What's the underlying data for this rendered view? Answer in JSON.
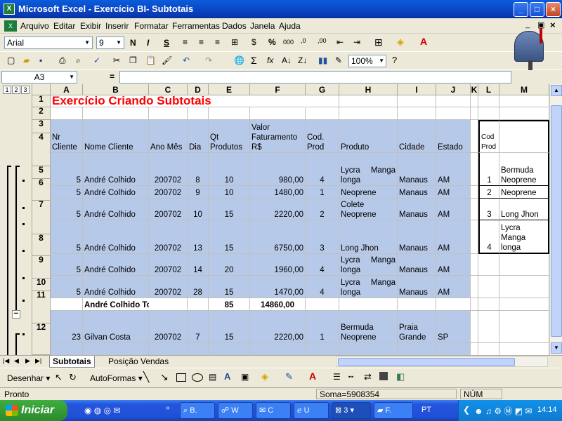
{
  "window": {
    "title": "Microsoft Excel - Exercício BI- Subtotais"
  },
  "menu": [
    "Arquivo",
    "Editar",
    "Exibir",
    "Inserir",
    "Formatar",
    "Ferramentas",
    "Dados",
    "Janela",
    "Ajuda"
  ],
  "format_toolbar": {
    "font": "Arial",
    "size": "9"
  },
  "standard_toolbar": {
    "zoom": "100%"
  },
  "formula_bar": {
    "name_box": "A3",
    "equals": "="
  },
  "outline_levels": [
    "1",
    "2",
    "3"
  ],
  "columns": [
    "A",
    "B",
    "C",
    "D",
    "E",
    "F",
    "G",
    "H",
    "I",
    "J",
    "K",
    "L",
    "M"
  ],
  "sheet": {
    "title": "Exercício Criando Subtotais",
    "headers": {
      "A": "Nr Cliente",
      "B": "Nome Cliente",
      "C": "Ano Mês",
      "D": "Dia",
      "E": "Qt Produtos",
      "F": "Valor Faturamento R$",
      "G": "Cod. Prod",
      "H": "Produto",
      "I": "Cidade",
      "J": "Estado",
      "L": "Cod Prod"
    },
    "rows": [
      {
        "n": "4",
        "A": "5",
        "B": "André Colhido",
        "C": "200702",
        "D": "8",
        "E": "10",
        "F": "980,00",
        "G": "4",
        "H": "Lycra Manga longa",
        "I": "Manaus",
        "J": "AM",
        "L": "1",
        "M": "Bermuda Neoprene"
      },
      {
        "n": "5",
        "A": "5",
        "B": "André Colhido",
        "C": "200702",
        "D": "9",
        "E": "10",
        "F": "1480,00",
        "G": "1",
        "H": "Neoprene",
        "I": "Manaus",
        "J": "AM",
        "L": "2",
        "M": "Neoprene"
      },
      {
        "n": "6",
        "A": "5",
        "B": "André Colhido",
        "C": "200702",
        "D": "10",
        "E": "15",
        "F": "2220,00",
        "G": "2",
        "H": "Colete Neoprene",
        "I": "Manaus",
        "J": "AM",
        "L": "3",
        "M": "Long Jhon"
      },
      {
        "n": "7",
        "A": "5",
        "B": "André Colhido",
        "C": "200702",
        "D": "13",
        "E": "15",
        "F": "6750,00",
        "G": "3",
        "H": "Long Jhon",
        "I": "Manaus",
        "J": "AM",
        "L": "4",
        "M": "Lycra Manga longa"
      },
      {
        "n": "8",
        "A": "5",
        "B": "André Colhido",
        "C": "200702",
        "D": "14",
        "E": "20",
        "F": "1960,00",
        "G": "4",
        "H": "Lycra Manga longa",
        "I": "Manaus",
        "J": "AM",
        "L": "",
        "M": ""
      },
      {
        "n": "9",
        "A": "5",
        "B": "André Colhido",
        "C": "200702",
        "D": "28",
        "E": "15",
        "F": "1470,00",
        "G": "4",
        "H": "Lycra Manga longa",
        "I": "Manaus",
        "J": "AM",
        "L": "",
        "M": ""
      },
      {
        "n": "10",
        "A": "",
        "B": "André Colhido Total",
        "C": "",
        "D": "",
        "E": "85",
        "F": "14860,00",
        "G": "",
        "H": "",
        "I": "",
        "J": "",
        "L": "",
        "M": ""
      },
      {
        "n": "11",
        "A": "23",
        "B": "Gilvan Costa",
        "C": "200702",
        "D": "7",
        "E": "15",
        "F": "2220,00",
        "G": "1",
        "H": "Bermuda Neoprene",
        "I": "Praia Grande",
        "J": "SP",
        "L": "",
        "M": ""
      },
      {
        "n": "12",
        "A": "",
        "B": "",
        "C": "",
        "D": "",
        "E": "",
        "F": "",
        "G": "",
        "H": "Lycra Manga",
        "I": "Praia",
        "J": "",
        "L": "",
        "M": ""
      }
    ]
  },
  "sheet_tabs": [
    "Subtotais",
    "Posição Vendas"
  ],
  "draw_toolbar": {
    "draw": "Desenhar",
    "autoshapes": "AutoFormas"
  },
  "status": {
    "ready": "Pronto",
    "sum": "Soma=5908354",
    "num": "NÚM"
  },
  "taskbar": {
    "start": "Iniciar",
    "tasks": [
      "B.",
      "W",
      "C",
      "U",
      "3",
      "F."
    ],
    "lang": "PT",
    "clock": "14:14"
  },
  "colors": {
    "accent": "#0a3fbd",
    "cell_blue": "#b7c9e8",
    "title_red": "#ff0000"
  }
}
